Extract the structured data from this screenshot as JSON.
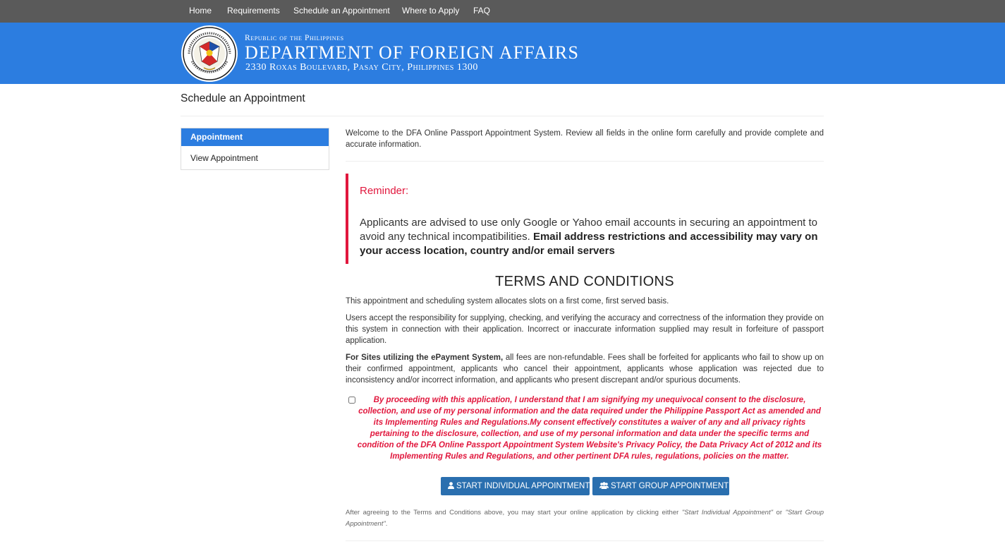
{
  "nav": {
    "items": [
      "Home",
      "Requirements",
      "Schedule an Appointment",
      "Where to Apply",
      "FAQ"
    ]
  },
  "banner": {
    "republic": "Republic of the Philippines",
    "department": "DEPARTMENT OF FOREIGN AFFAIRS",
    "address": "2330 Roxas Boulevard, Pasay City, Philippines 1300"
  },
  "page": {
    "title": "Schedule an Appointment"
  },
  "sidebar": {
    "items": [
      "Appointment",
      "View Appointment"
    ]
  },
  "main": {
    "welcome": "Welcome to the DFA Online Passport Appointment System. Review all fields in the online form carefully and provide complete and accurate information.",
    "reminder_title": "Reminder:",
    "reminder_text": "Applicants are advised to use only Google or Yahoo email accounts in securing an appointment to avoid any technical incompatibilities.",
    "reminder_bold": "Email address restrictions and accessibility may vary on your access location, country and/or email servers",
    "terms_title": "TERMS AND CONDITIONS",
    "terms_p1": "This appointment and scheduling system allocates slots on a first come, first served basis.",
    "terms_p2": "Users accept the responsibility for supplying, checking, and verifying the accuracy and correctness of the information they provide on this system in connection with their application. Incorrect or inaccurate information supplied may result in forfeiture of passport application.",
    "terms_p3_bold": "For Sites utilizing the ePayment System,",
    "terms_p3": "all fees are non-refundable. Fees shall be forfeited for applicants who fail to show up on their confirmed appointment, applicants who cancel their appointment, applicants whose application was rejected due to inconsistency and/or incorrect information, and applicants who present discrepant and/or spurious documents.",
    "consent": "By proceeding with this application, I understand that I am signifying my unequivocal consent to the disclosure, collection, and use of my personal information and the data required under the Philippine Passport Act as amended and its Implementing Rules and Regulations.My consent effectively constitutes a waiver of any and all privacy rights pertaining to the disclosure, collection, and use of my personal information and data under the specific terms and condition of the DFA Online Passport Appointment System Website's Privacy Policy, the Data Privacy Act of 2012 and its Implementing Rules and Regulations, and other pertinent DFA rules, regulations, policies on the matter.",
    "consent_checked": false,
    "btn_individual": "START INDIVIDUAL APPOINTMENT",
    "btn_group": "START GROUP APPOINTMENT",
    "after_pre": "After agreeing to the Terms and Conditions above, you may start your online application by clicking either",
    "after_q1": "\"Start Individual Appointment\"",
    "after_or": "or",
    "after_q2": "\"Start Group Appointment\"",
    "after_end": "."
  },
  "colors": {
    "nav_bg": "#5a5a5a",
    "banner_bg": "#2c7de0",
    "accent_red": "#e1173d",
    "button_bg": "#2a6faf"
  },
  "icons": {
    "seal": "dfa-seal-icon",
    "individual": "user-icon",
    "group": "users-icon"
  }
}
